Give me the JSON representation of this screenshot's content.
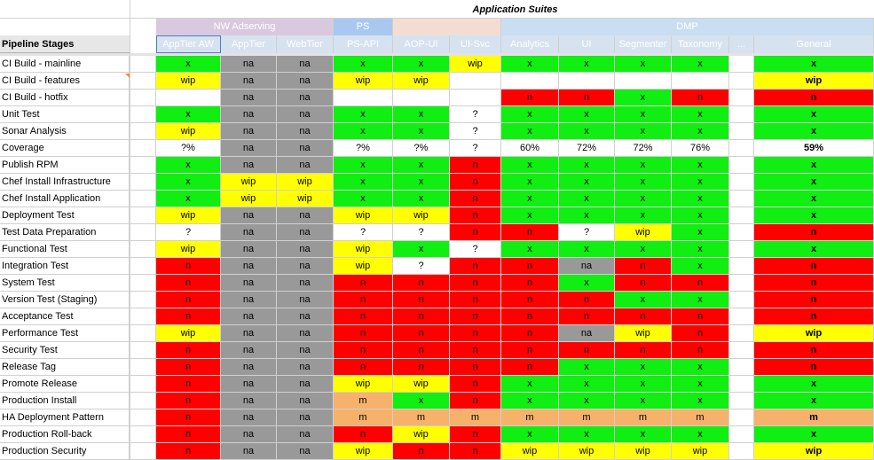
{
  "sheet": {
    "title": "Application Suites",
    "stages_header": "Pipeline Stages",
    "groups": [
      {
        "label": "NW Adserving",
        "color": "#d9c9de"
      },
      {
        "label": "PS",
        "color": "#a9c8f0"
      },
      {
        "label": "",
        "color": "#f3ddd2"
      },
      {
        "label": "DMP",
        "color": "#c9def0"
      }
    ],
    "columns": [
      "AppTier AW",
      "AppTier",
      "WebTier",
      "PS-API",
      "AOP-UI",
      "UI-Svc",
      "Analytics",
      "UI",
      "Segmenter",
      "Taxonomy",
      "...",
      "General"
    ],
    "rows": [
      {
        "stage": "CI Build - mainline",
        "values": [
          "x",
          "na",
          "na",
          "x",
          "x",
          "wip",
          "x",
          "x",
          "x",
          "x",
          "",
          "x"
        ],
        "colors": [
          "g",
          "gr",
          "gr",
          "g",
          "g",
          "y",
          "g",
          "g",
          "g",
          "g",
          "w",
          "g"
        ]
      },
      {
        "stage": "CI Build - features",
        "values": [
          "wip",
          "na",
          "na",
          "wip",
          "wip",
          "",
          "",
          "",
          "",
          "",
          "",
          "wip"
        ],
        "colors": [
          "y",
          "gr",
          "gr",
          "y",
          "y",
          "w",
          "w",
          "w",
          "w",
          "w",
          "w",
          "y"
        ]
      },
      {
        "stage": "CI Build - hotfix",
        "values": [
          "",
          "na",
          "na",
          "",
          "",
          "",
          "n",
          "n",
          "x",
          "n",
          "",
          "n"
        ],
        "colors": [
          "w",
          "gr",
          "gr",
          "w",
          "w",
          "w",
          "r",
          "r",
          "g",
          "r",
          "w",
          "r"
        ]
      },
      {
        "stage": "Unit Test",
        "values": [
          "x",
          "na",
          "na",
          "x",
          "x",
          "?",
          "x",
          "x",
          "x",
          "x",
          "",
          "x"
        ],
        "colors": [
          "g",
          "gr",
          "gr",
          "g",
          "g",
          "w",
          "g",
          "g",
          "g",
          "g",
          "w",
          "g"
        ]
      },
      {
        "stage": "Sonar Analysis",
        "values": [
          "wip",
          "na",
          "na",
          "x",
          "x",
          "?",
          "x",
          "x",
          "x",
          "x",
          "",
          "x"
        ],
        "colors": [
          "y",
          "gr",
          "gr",
          "g",
          "g",
          "w",
          "g",
          "g",
          "g",
          "g",
          "w",
          "g"
        ]
      },
      {
        "stage": "Coverage",
        "values": [
          "?%",
          "na",
          "na",
          "?%",
          "?%",
          "?",
          "60%",
          "72%",
          "72%",
          "76%",
          "",
          "59%"
        ],
        "colors": [
          "w",
          "gr",
          "gr",
          "w",
          "w",
          "w",
          "w",
          "w",
          "w",
          "w",
          "w",
          "w"
        ]
      },
      {
        "stage": "Publish RPM",
        "values": [
          "x",
          "na",
          "na",
          "x",
          "x",
          "n",
          "x",
          "x",
          "x",
          "x",
          "",
          "x"
        ],
        "colors": [
          "g",
          "gr",
          "gr",
          "g",
          "g",
          "r",
          "g",
          "g",
          "g",
          "g",
          "w",
          "g"
        ]
      },
      {
        "stage": "Chef Install Infrastructure",
        "values": [
          "x",
          "wip",
          "wip",
          "x",
          "x",
          "n",
          "x",
          "x",
          "x",
          "x",
          "",
          "x"
        ],
        "colors": [
          "g",
          "y",
          "y",
          "g",
          "g",
          "r",
          "g",
          "g",
          "g",
          "g",
          "w",
          "g"
        ]
      },
      {
        "stage": "Chef Install Application",
        "values": [
          "x",
          "wip",
          "wip",
          "x",
          "x",
          "n",
          "x",
          "x",
          "x",
          "x",
          "",
          "x"
        ],
        "colors": [
          "g",
          "y",
          "y",
          "g",
          "g",
          "r",
          "g",
          "g",
          "g",
          "g",
          "w",
          "g"
        ]
      },
      {
        "stage": "Deployment Test",
        "values": [
          "wip",
          "na",
          "na",
          "wip",
          "wip",
          "n",
          "x",
          "x",
          "x",
          "x",
          "",
          "x"
        ],
        "colors": [
          "y",
          "gr",
          "gr",
          "y",
          "y",
          "r",
          "g",
          "g",
          "g",
          "g",
          "w",
          "g"
        ]
      },
      {
        "stage": "Test Data Preparation",
        "values": [
          "?",
          "na",
          "na",
          "?",
          "?",
          "n",
          "n",
          "?",
          "wip",
          "x",
          "",
          "n"
        ],
        "colors": [
          "w",
          "gr",
          "gr",
          "w",
          "w",
          "r",
          "r",
          "w",
          "y",
          "g",
          "w",
          "r"
        ]
      },
      {
        "stage": "Functional Test",
        "values": [
          "wip",
          "na",
          "na",
          "wip",
          "x",
          "?",
          "x",
          "x",
          "x",
          "x",
          "",
          "x"
        ],
        "colors": [
          "y",
          "gr",
          "gr",
          "y",
          "g",
          "w",
          "g",
          "g",
          "g",
          "g",
          "w",
          "g"
        ]
      },
      {
        "stage": "Integration Test",
        "values": [
          "n",
          "na",
          "na",
          "wip",
          "?",
          "n",
          "n",
          "na",
          "n",
          "x",
          "",
          "n"
        ],
        "colors": [
          "r",
          "gr",
          "gr",
          "y",
          "w",
          "r",
          "r",
          "gr",
          "r",
          "g",
          "w",
          "r"
        ]
      },
      {
        "stage": "System Test",
        "values": [
          "n",
          "na",
          "na",
          "n",
          "n",
          "n",
          "n",
          "x",
          "n",
          "n",
          "",
          "n"
        ],
        "colors": [
          "r",
          "gr",
          "gr",
          "r",
          "r",
          "r",
          "r",
          "g",
          "r",
          "r",
          "w",
          "r"
        ]
      },
      {
        "stage": "Version Test (Staging)",
        "values": [
          "n",
          "na",
          "na",
          "n",
          "n",
          "n",
          "n",
          "n",
          "x",
          "x",
          "",
          "n"
        ],
        "colors": [
          "r",
          "gr",
          "gr",
          "r",
          "r",
          "r",
          "r",
          "r",
          "g",
          "g",
          "w",
          "r"
        ]
      },
      {
        "stage": "Acceptance Test",
        "values": [
          "n",
          "na",
          "na",
          "n",
          "n",
          "n",
          "n",
          "n",
          "n",
          "n",
          "",
          "n"
        ],
        "colors": [
          "r",
          "gr",
          "gr",
          "r",
          "r",
          "r",
          "r",
          "r",
          "r",
          "r",
          "w",
          "r"
        ]
      },
      {
        "stage": "Performance Test",
        "values": [
          "wip",
          "na",
          "na",
          "n",
          "n",
          "n",
          "n",
          "na",
          "wip",
          "n",
          "",
          "wip"
        ],
        "colors": [
          "y",
          "gr",
          "gr",
          "r",
          "r",
          "r",
          "r",
          "gr",
          "y",
          "r",
          "w",
          "y"
        ]
      },
      {
        "stage": "Security Test",
        "values": [
          "n",
          "na",
          "na",
          "n",
          "n",
          "n",
          "n",
          "n",
          "n",
          "n",
          "",
          "n"
        ],
        "colors": [
          "r",
          "gr",
          "gr",
          "r",
          "r",
          "r",
          "r",
          "r",
          "r",
          "r",
          "w",
          "r"
        ]
      },
      {
        "stage": "Release Tag",
        "values": [
          "n",
          "na",
          "na",
          "n",
          "n",
          "n",
          "n",
          "x",
          "x",
          "x",
          "",
          "n"
        ],
        "colors": [
          "r",
          "gr",
          "gr",
          "r",
          "r",
          "r",
          "r",
          "g",
          "g",
          "g",
          "w",
          "r"
        ]
      },
      {
        "stage": "Promote Release",
        "values": [
          "n",
          "na",
          "na",
          "wip",
          "wip",
          "n",
          "x",
          "x",
          "x",
          "x",
          "",
          "x"
        ],
        "colors": [
          "r",
          "gr",
          "gr",
          "y",
          "y",
          "r",
          "g",
          "g",
          "g",
          "g",
          "w",
          "g"
        ]
      },
      {
        "stage": "Production Install",
        "values": [
          "n",
          "na",
          "na",
          "m",
          "x",
          "n",
          "x",
          "x",
          "x",
          "x",
          "",
          "x"
        ],
        "colors": [
          "r",
          "gr",
          "gr",
          "o",
          "g",
          "r",
          "g",
          "g",
          "g",
          "g",
          "w",
          "g"
        ]
      },
      {
        "stage": "HA Deployment Pattern",
        "values": [
          "n",
          "na",
          "na",
          "m",
          "m",
          "m",
          "m",
          "m",
          "m",
          "m",
          "",
          "m"
        ],
        "colors": [
          "r",
          "gr",
          "gr",
          "o",
          "o",
          "o",
          "o",
          "o",
          "o",
          "o",
          "w",
          "o"
        ]
      },
      {
        "stage": "Production Roll-back",
        "values": [
          "n",
          "na",
          "na",
          "n",
          "wip",
          "n",
          "x",
          "x",
          "x",
          "x",
          "",
          "x"
        ],
        "colors": [
          "r",
          "gr",
          "gr",
          "r",
          "y",
          "r",
          "g",
          "g",
          "g",
          "g",
          "w",
          "g"
        ]
      },
      {
        "stage": "Production Security",
        "values": [
          "n",
          "na",
          "na",
          "wip",
          "n",
          "n",
          "wip",
          "wip",
          "wip",
          "wip",
          "",
          "wip"
        ],
        "colors": [
          "r",
          "gr",
          "gr",
          "y",
          "r",
          "r",
          "y",
          "y",
          "y",
          "y",
          "w",
          "y"
        ]
      }
    ]
  }
}
